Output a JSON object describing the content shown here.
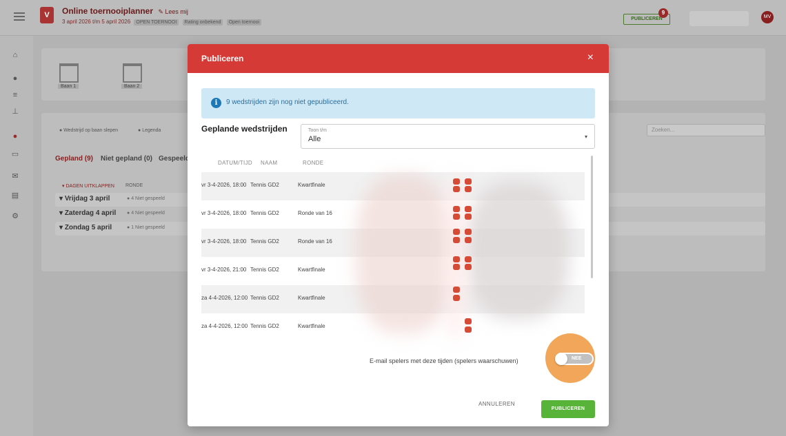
{
  "header": {
    "logo_glyph": "V",
    "app_title": "Online toernooiplanner",
    "edit_label": "Lees mij",
    "subtitle": "3 april 2026 t/m 5 april 2026",
    "chips": [
      "OPEN TOERNOOI",
      "Rating onbekend",
      "Open toernooi"
    ],
    "publish_label": "PUBLICEREN",
    "publish_badge": "9",
    "avatar_initials": "MV"
  },
  "sidebar": {
    "icons": [
      "home-icon",
      "users-icon",
      "list-icon",
      "bracket-icon",
      "ball-icon",
      "monitor-icon",
      "mail-icon",
      "document-icon",
      "gear-icon"
    ]
  },
  "background": {
    "courts": [
      "Baan 1",
      "Baan 2"
    ],
    "filter_chips": [
      "Wedstrijd op baan slepen",
      "Legenda"
    ],
    "search_placeholder": "Zoeken...",
    "tabs": [
      "Gepland (9)",
      "Niet gepland (0)",
      "Gespeeld"
    ],
    "collapse_header": "DAGEN UITKLAPPEN",
    "ronde_header": "RONDE",
    "days": [
      {
        "label": "Vrijdag 3 april",
        "note": "4 Niet gespeeld"
      },
      {
        "label": "Zaterdag 4 april",
        "note": "4 Niet gespeeld"
      },
      {
        "label": "Zondag 5 april",
        "note": "1 Niet gespeeld"
      }
    ]
  },
  "modal": {
    "title": "Publiceren",
    "close_glyph": "×",
    "info_text": "9 wedstrijden zijn nog niet gepubliceerd.",
    "section_title": "Geplande wedstrijden",
    "select": {
      "label": "Toon t/m",
      "value": "Alle",
      "arrow": "▾"
    },
    "columns": {
      "datetime": "DATUM/TIJD",
      "name": "NAAM",
      "round": "RONDE"
    },
    "rows": [
      {
        "datetime": "vr 3-4-2026, 18:00",
        "name": "Tennis GD2",
        "round": "Kwartfinale"
      },
      {
        "datetime": "vr 3-4-2026, 18:00",
        "name": "Tennis GD2",
        "round": "Ronde van 16"
      },
      {
        "datetime": "vr 3-4-2026, 18:00",
        "name": "Tennis GD2",
        "round": "Ronde van 16"
      },
      {
        "datetime": "vr 3-4-2026, 21:00",
        "name": "Tennis GD2",
        "round": "Kwartfinale"
      },
      {
        "datetime": "za 4-4-2026, 12:00",
        "name": "Tennis GD2",
        "round": "Kwartfinale"
      },
      {
        "datetime": "za 4-4-2026, 12:00",
        "name": "Tennis GD2",
        "round": "Kwartfinale"
      }
    ],
    "email_label": "E-mail spelers met deze tijden (spelers waarschuwen)",
    "toggle_label": "NEE",
    "cancel_label": "ANNULEREN",
    "publish_label": "PUBLICEREN"
  },
  "colors": {
    "modal_header": "#d63a37",
    "publish_button": "#58b438",
    "info_background": "#cfe8f6",
    "highlight": "#f0963c",
    "marker": "#d64b35"
  }
}
